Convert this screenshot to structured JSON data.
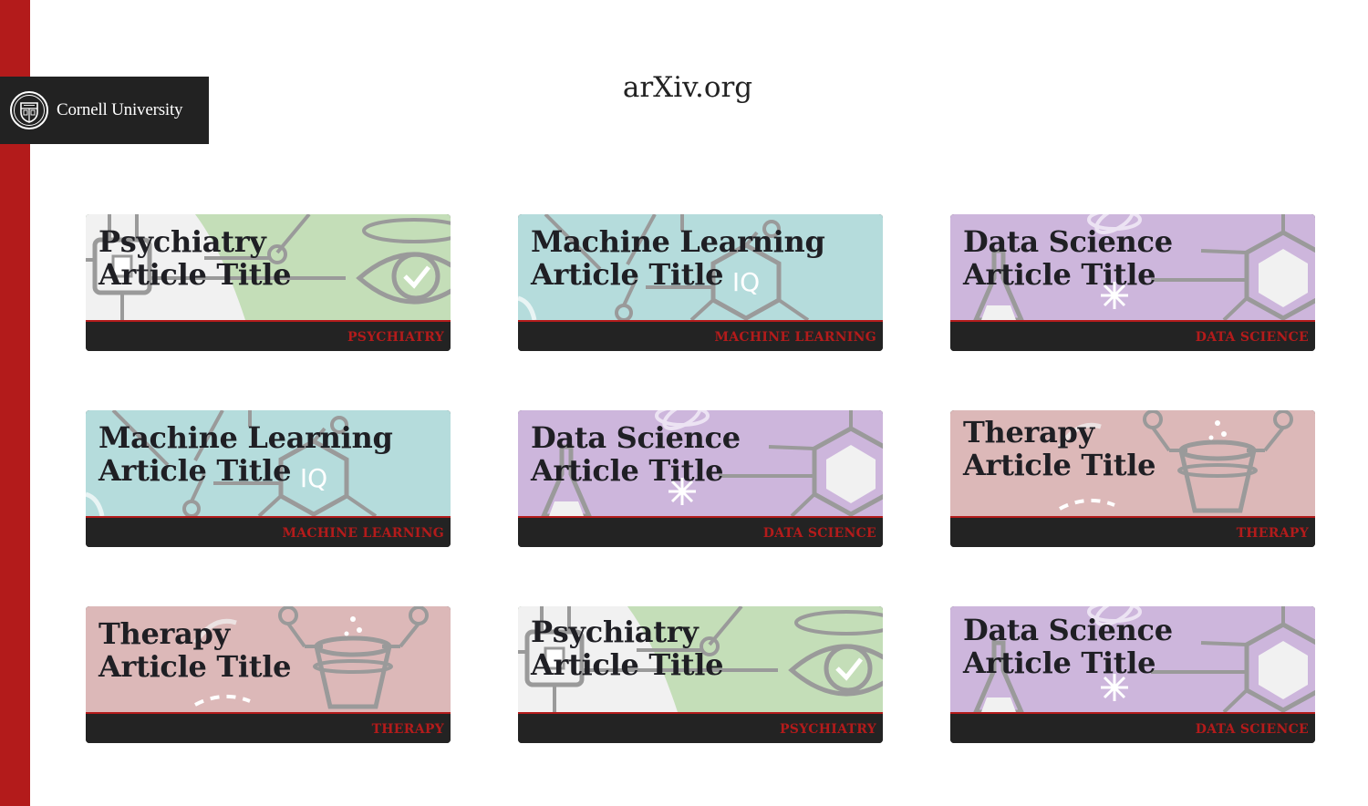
{
  "branding": {
    "institution": "Cornell University",
    "site": "arXiv.org",
    "accent_color": "#b31b1b",
    "badge_color": "#222222"
  },
  "theme_colors": {
    "psychiatry": "#c4deb8",
    "machine_learning": "#b5dcdc",
    "data_science": "#cdb6dc",
    "therapy": "#dcb8b8"
  },
  "cards": [
    {
      "topic": "psychiatry",
      "title_line1": "Psychiatry",
      "title_line2": "Article Title",
      "tag": "PSYCHIATRY"
    },
    {
      "topic": "machine_learning",
      "title_line1": "Machine Learning",
      "title_line2": "Article Title",
      "tag": "MACHINE LEARNING"
    },
    {
      "topic": "data_science",
      "title_line1": "Data Science",
      "title_line2": "Article Title",
      "tag": "DATA SCIENCE"
    },
    {
      "topic": "machine_learning",
      "title_line1": "Machine Learning",
      "title_line2": "Article Title",
      "tag": "MACHINE LEARNING"
    },
    {
      "topic": "data_science",
      "title_line1": "Data Science",
      "title_line2": "Article Title",
      "tag": "DATA SCIENCE"
    },
    {
      "topic": "therapy",
      "title_line1": "Therapy",
      "title_line2": "Article Title",
      "tag": "THERAPY"
    },
    {
      "topic": "therapy",
      "title_line1": "Therapy",
      "title_line2": "Article Title",
      "tag": "THERAPY"
    },
    {
      "topic": "psychiatry",
      "title_line1": "Psychiatry",
      "title_line2": "Article Title",
      "tag": "PSYCHIATRY"
    },
    {
      "topic": "data_science",
      "title_line1": "Data Science",
      "title_line2": "Article Title",
      "tag": "DATA SCIENCE"
    }
  ]
}
